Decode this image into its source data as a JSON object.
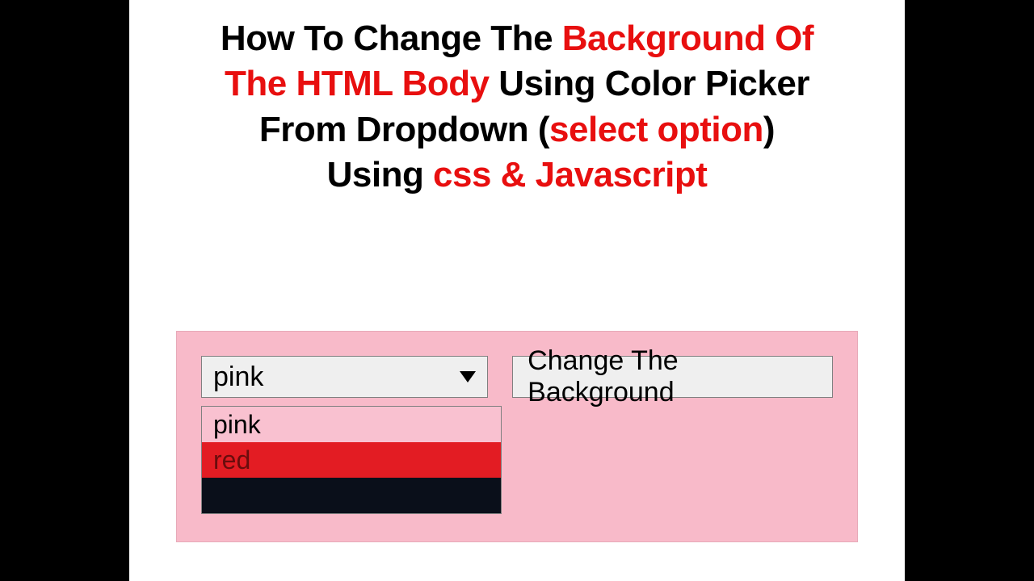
{
  "title": {
    "t1": "How To Change The ",
    "t2": "Background Of",
    "t3": "The HTML Body",
    "t4": "  Using Color Picker",
    "t5": "From Dropdown (",
    "t6": "select option",
    "t7": ")",
    "t8": "Using ",
    "t9": "css & Javascript"
  },
  "demo": {
    "selected": "pink",
    "button_label": "Change The Background",
    "options": [
      {
        "label": "pink"
      },
      {
        "label": "red"
      },
      {
        "label": ""
      }
    ]
  }
}
